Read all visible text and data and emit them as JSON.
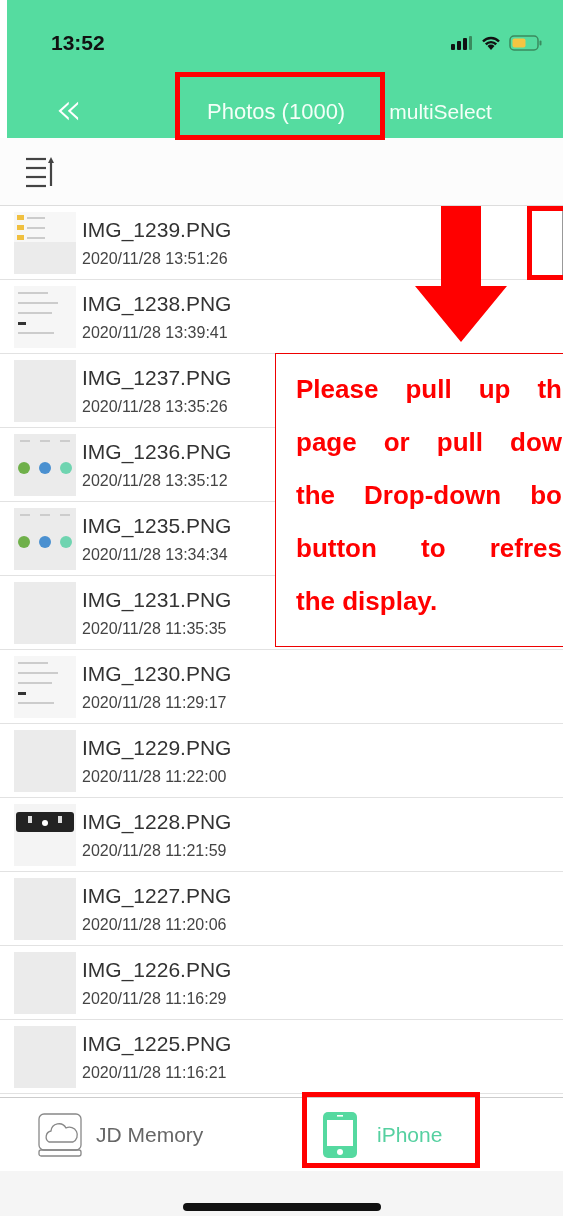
{
  "status_bar": {
    "time": "13:52"
  },
  "nav": {
    "back": "«",
    "title": "Photos (1000)",
    "action": "multiSelect"
  },
  "files": [
    {
      "name": "IMG_1239.PNG",
      "date": "2020/11/28 13:51:26",
      "kind": "folders"
    },
    {
      "name": "IMG_1238.PNG",
      "date": "2020/11/28 13:39:41",
      "kind": "list"
    },
    {
      "name": "IMG_1237.PNG",
      "date": "2020/11/28 13:35:26",
      "kind": "blank"
    },
    {
      "name": "IMG_1236.PNG",
      "date": "2020/11/28 13:35:12",
      "kind": "icons"
    },
    {
      "name": "IMG_1235.PNG",
      "date": "2020/11/28 13:34:34",
      "kind": "icons"
    },
    {
      "name": "IMG_1231.PNG",
      "date": "2020/11/28 11:35:35",
      "kind": "blank"
    },
    {
      "name": "IMG_1230.PNG",
      "date": "2020/11/28 11:29:17",
      "kind": "list"
    },
    {
      "name": "IMG_1229.PNG",
      "date": "2020/11/28 11:22:00",
      "kind": "blank"
    },
    {
      "name": "IMG_1228.PNG",
      "date": "2020/11/28 11:21:59",
      "kind": "dark"
    },
    {
      "name": "IMG_1227.PNG",
      "date": "2020/11/28 11:20:06",
      "kind": "blank"
    },
    {
      "name": "IMG_1226.PNG",
      "date": "2020/11/28 11:16:29",
      "kind": "blank"
    },
    {
      "name": "IMG_1225.PNG",
      "date": "2020/11/28 11:16:21",
      "kind": "blank"
    }
  ],
  "callout": {
    "lines": [
      "Please pull up th",
      "page or pull dow",
      "the Drop-down bo",
      "button to refres",
      "the display."
    ]
  },
  "tabs": [
    {
      "label": "JD Memory",
      "selected": false
    },
    {
      "label": "iPhone",
      "selected": true
    }
  ]
}
